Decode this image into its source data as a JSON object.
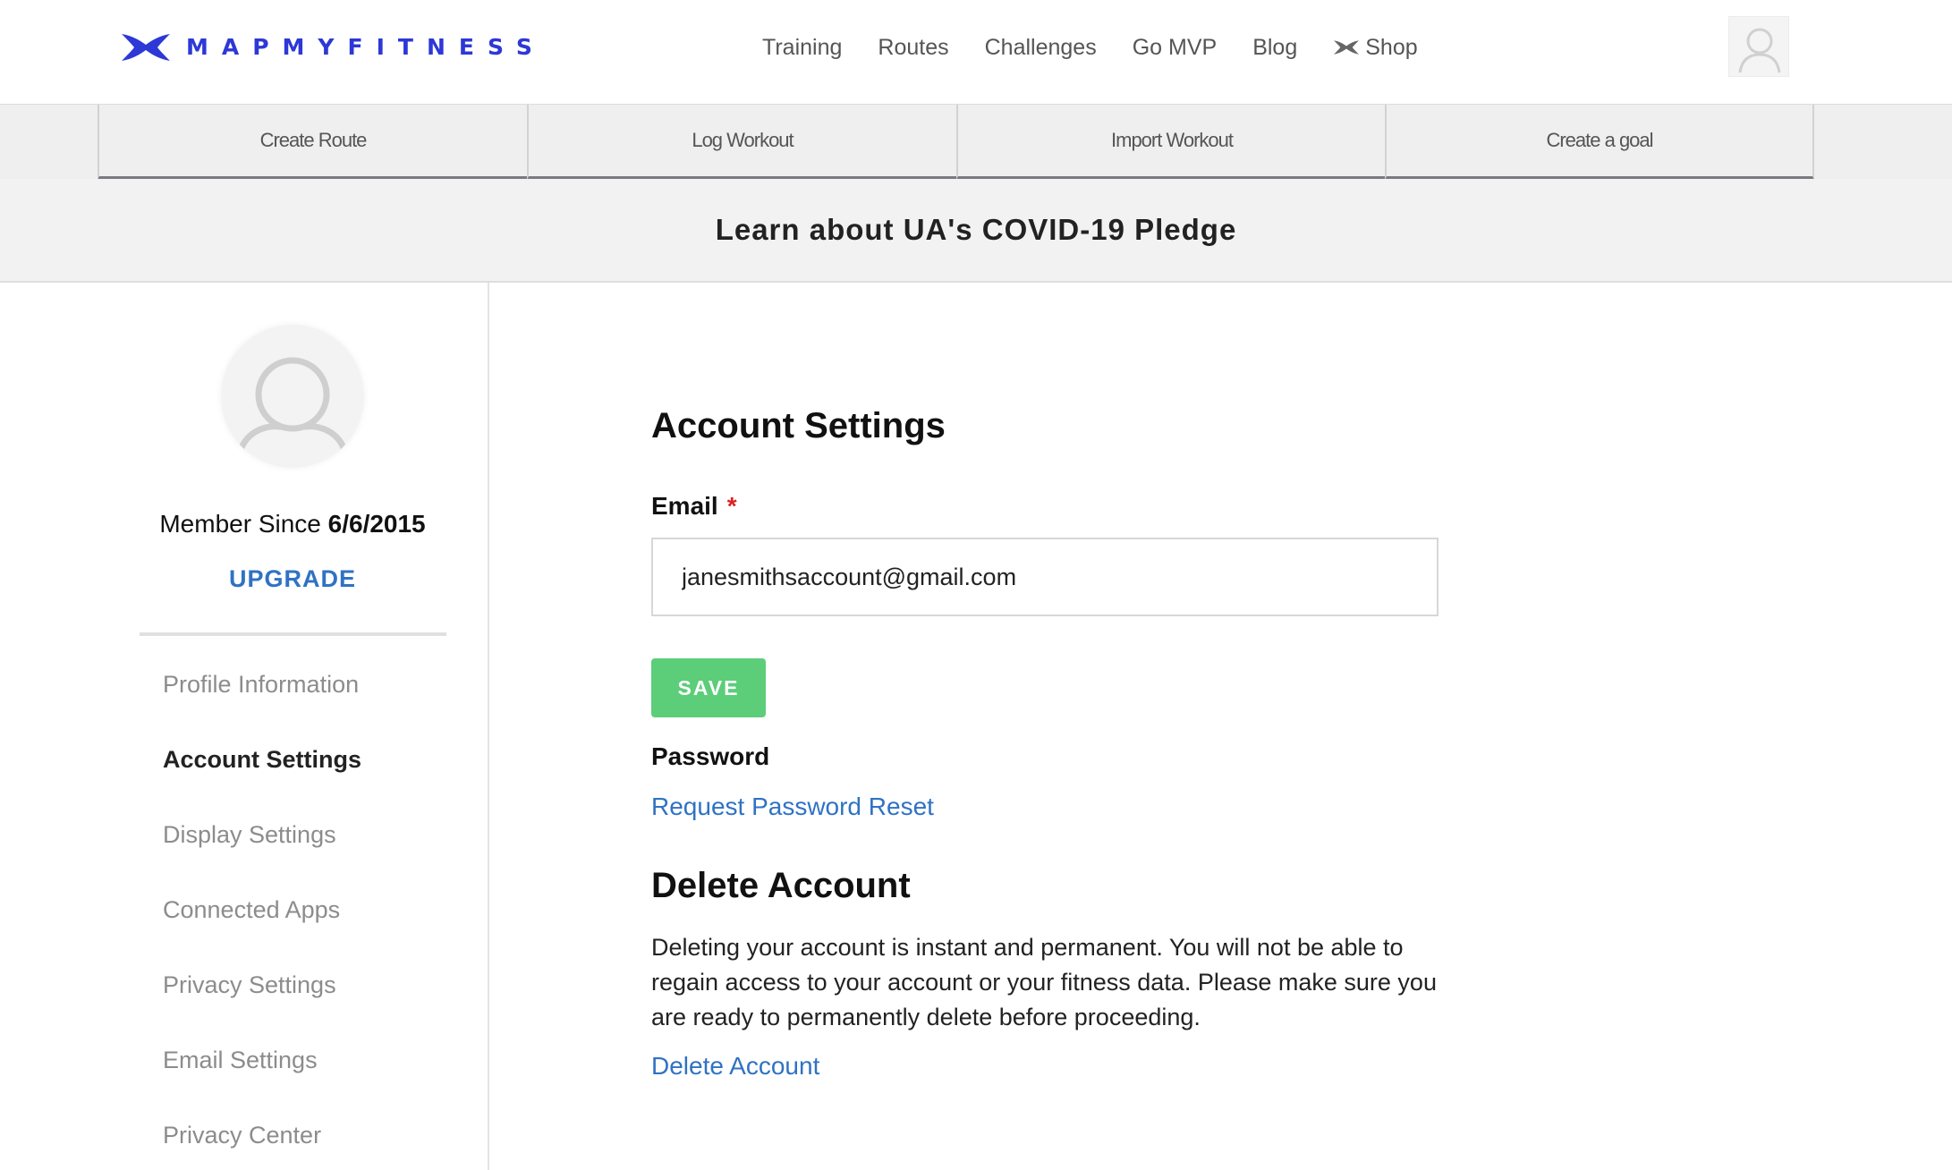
{
  "header": {
    "logo_text": "MAPMYFITNESS",
    "nav": [
      {
        "label": "Training"
      },
      {
        "label": "Routes"
      },
      {
        "label": "Challenges"
      },
      {
        "label": "Go MVP"
      },
      {
        "label": "Blog"
      },
      {
        "label": "Shop",
        "icon": "under-armour-icon"
      }
    ],
    "brand_color": "#2d38d6"
  },
  "actions": [
    {
      "label": "Create Route"
    },
    {
      "label": "Log Workout"
    },
    {
      "label": "Import Workout"
    },
    {
      "label": "Create a goal"
    }
  ],
  "banner": {
    "text": "Learn about UA's COVID-19 Pledge"
  },
  "sidebar": {
    "member_since_label": "Member Since",
    "member_since_date": "6/6/2015",
    "upgrade_label": "UPGRADE",
    "items": [
      {
        "label": "Profile Information",
        "active": false
      },
      {
        "label": "Account Settings",
        "active": true
      },
      {
        "label": "Display Settings",
        "active": false
      },
      {
        "label": "Connected Apps",
        "active": false
      },
      {
        "label": "Privacy Settings",
        "active": false
      },
      {
        "label": "Email Settings",
        "active": false
      },
      {
        "label": "Privacy Center",
        "active": false
      }
    ]
  },
  "main": {
    "title": "Account Settings",
    "email_label": "Email",
    "required_mark": "*",
    "email_value": "janesmithsaccount@gmail.com",
    "save_label": "SAVE",
    "password_label": "Password",
    "reset_link": "Request Password Reset",
    "delete_title": "Delete Account",
    "delete_text": "Deleting your account is instant and permanent. You will not be able to regain access to your account or your fitness data. Please make sure you are ready to permanently delete before proceeding.",
    "delete_link": "Delete Account",
    "accent_color": "#2f72c4",
    "save_color": "#5ccd78"
  }
}
